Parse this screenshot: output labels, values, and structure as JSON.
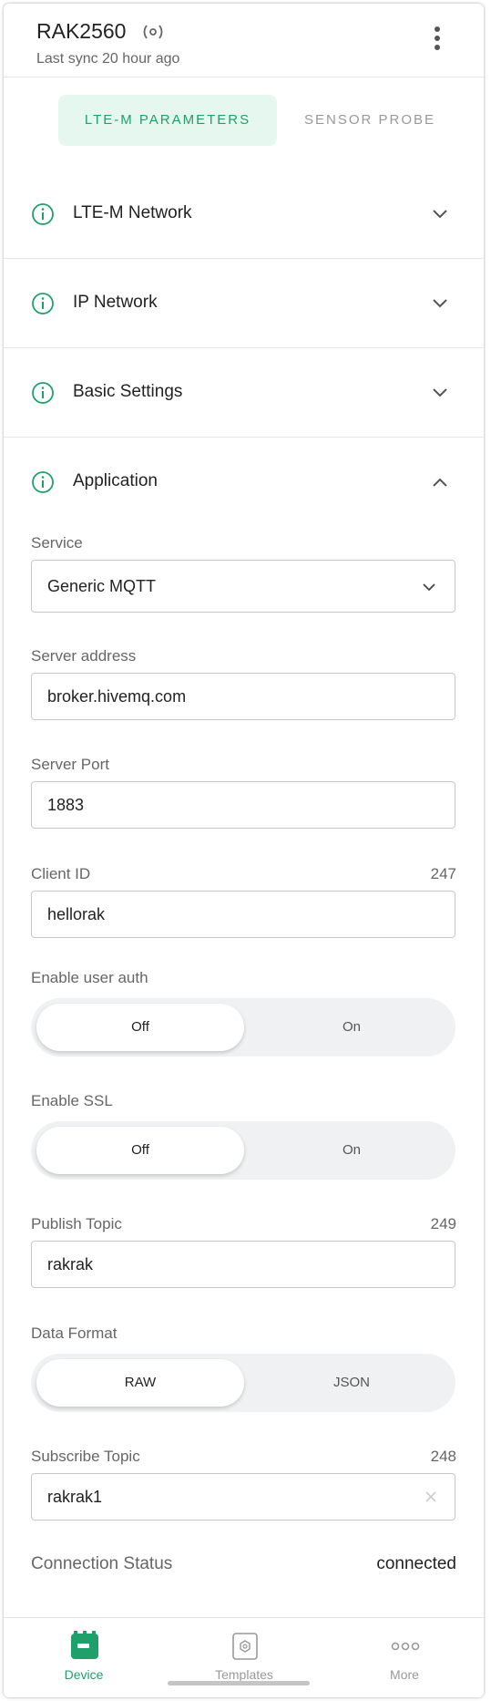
{
  "header": {
    "device_name": "RAK2560",
    "last_sync": "Last sync 20 hour ago"
  },
  "tabs": [
    {
      "label": "LTE-M PARAMETERS",
      "active": true
    },
    {
      "label": "SENSOR PROBE",
      "active": false
    }
  ],
  "sections": [
    {
      "title": "LTE-M Network",
      "expanded": false
    },
    {
      "title": "IP Network",
      "expanded": false
    },
    {
      "title": "Basic Settings",
      "expanded": false
    },
    {
      "title": "Application",
      "expanded": true
    }
  ],
  "application": {
    "service": {
      "label": "Service",
      "value": "Generic MQTT"
    },
    "server_address": {
      "label": "Server address",
      "value": "broker.hivemq.com"
    },
    "server_port": {
      "label": "Server Port",
      "value": "1883"
    },
    "client_id": {
      "label": "Client ID",
      "value": "hellorak",
      "remaining": "247"
    },
    "user_auth": {
      "label": "Enable user auth",
      "options": [
        "Off",
        "On"
      ],
      "selected": "Off"
    },
    "ssl": {
      "label": "Enable SSL",
      "options": [
        "Off",
        "On"
      ],
      "selected": "Off"
    },
    "publish_topic": {
      "label": "Publish Topic",
      "value": "rakrak",
      "remaining": "249"
    },
    "data_format": {
      "label": "Data Format",
      "options": [
        "RAW",
        "JSON"
      ],
      "selected": "RAW"
    },
    "subscribe_topic": {
      "label": "Subscribe Topic",
      "value": "rakrak1",
      "remaining": "248"
    },
    "connection_status": {
      "label": "Connection Status",
      "value": "connected"
    }
  },
  "bottom_nav": [
    {
      "label": "Device",
      "icon": "device-icon",
      "active": true
    },
    {
      "label": "Templates",
      "icon": "templates-icon",
      "active": false
    },
    {
      "label": "More",
      "icon": "more-dots-icon",
      "active": false
    }
  ],
  "colors": {
    "accent": "#1fa06a",
    "accent_bg": "#e6f7ef",
    "toggle_bg": "#f0f1f3"
  }
}
